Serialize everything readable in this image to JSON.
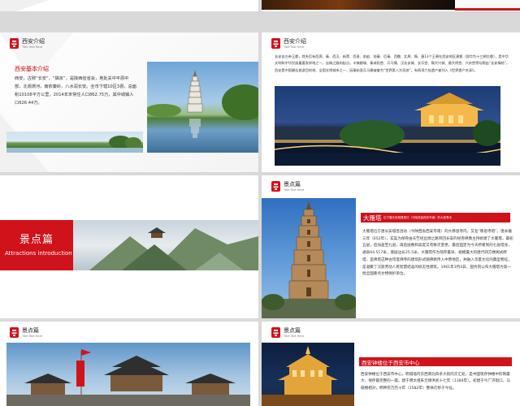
{
  "slides": {
    "s3": {
      "header_title": "西安介绍",
      "header_sub": "Title Text Here",
      "section_title": "西安基本介绍",
      "body": "西安，古称“长安”、“镐京”，是陕西省省会，地处关中平原中部，北濒渭河，南依秦岭，八水润长安。全市下辖10区3县，总面积10108平方公里，2014年末常住人口862.75万，其中城镇人口626.44万。"
    },
    "s4": {
      "header_title": "西安介绍",
      "header_sub": "Title Text Here",
      "body": "长安自古帝王都，其先后有西周、秦、西汉、新莽、西晋、前赵、前秦、后秦、西魏、北周、隋、唐13个王朝在西安地区建都（即华为十三朝古都），是中华文明和中华民族重要发祥地之一，丝绸之路的起点。丰镐都城、秦咸阳宫、兵马俑、汉长安城、长乐宫、隋大兴城、唐大明宫、兴庆宫等勾勒出“长安情结”，西安是中国最佳旅游目的地、全国文明城市之一，因秦始皇兵马俑被誉为“世界第八大奇迹”，有两项六处遗产被列入《世界遗产名录》。"
    },
    "s5": {
      "title_cn": "景点篇",
      "title_en": "Attractions introduction"
    },
    "s6": {
      "header_title": "景点篇",
      "header_sub": "Title Text Here",
      "banner_big": "大雁塔",
      "banner_small": "位于唐长安城晋昌坊（今陕西省西安市南）的大慈恩寺",
      "body": "大雁塔位于唐长安城晋昌坊（今陕西省西安市南）的大慈恩寺内，又名“慈恩寺塔”。唐永徽三年（652年），玄奘为保存由天竺经丝绸之路带回长安的经卷佛像主持修建了大雁塔，最初五层，后加盖至九层，再后层数和高度又有数次变更，最后固定为今天所看到的七层塔身，通高64.517米，底层边长25.5米。大雁塔作为现存最早、规模最大的唐代四方楼阁式砖塔，是佛塔这种古印度佛寺的建筑形式随佛教传入中原地区，并融入华夏文化的典型物证，是凝聚了汉族劳动人民智慧结晶的标志性建筑。1961年3月4日，国务院公布大雁塔为第一批全国重点文物保护单位。"
    },
    "s7": {
      "header_title": "景点篇",
      "header_sub": "Title Text Here"
    },
    "s8": {
      "header_title": "景点篇",
      "header_sub": "Title Text Here",
      "banner": "西安钟楼位于西安市中心",
      "body": "西安钟楼位于西安市中心，明城墙内东西南北四条大街的交汇处，是中国现存钟楼中形制最大、保存最完整的一座。建于明太祖朱元璋洪武十七年（1384年），初建于今广济街口，与鼓楼相对，明神宗万历十年（1582年）整体迁移于今址。"
    }
  },
  "colors": {
    "accent": "#d0121b",
    "dark_text": "#333333"
  }
}
